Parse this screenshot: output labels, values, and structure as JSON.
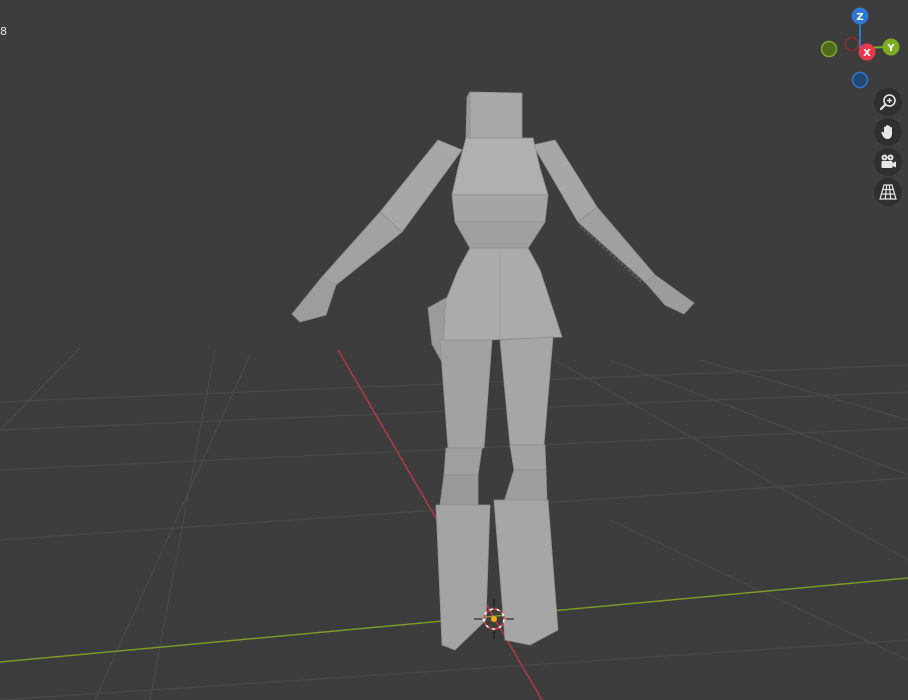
{
  "viewport": {
    "overlay_text": "8",
    "colors": {
      "background": "#3d3d3d",
      "grid": "#4a4a4a",
      "x_axis": "#b13b47",
      "y_axis": "#7a9a2a",
      "mesh": "#a9a9a9"
    }
  },
  "axis_gizmo": {
    "z_label": "Z",
    "y_label": "Y",
    "x_label": "X",
    "colors": {
      "x": "#e8394a",
      "y": "#7bac22",
      "z": "#2e78d2"
    }
  },
  "navigation_buttons": [
    {
      "icon": "zoom-icon",
      "tooltip": ""
    },
    {
      "icon": "hand-pan-icon",
      "tooltip": ""
    },
    {
      "icon": "camera-view-icon",
      "tooltip": ""
    },
    {
      "icon": "perspective-grid-icon",
      "tooltip": ""
    }
  ]
}
